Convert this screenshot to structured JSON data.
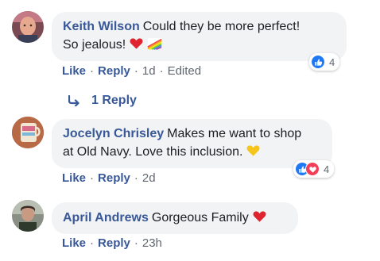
{
  "comments": [
    {
      "author": "Keith Wilson",
      "text_line1": "Could they be more perfect!",
      "text_line2": "So jealous!",
      "emojis": [
        "red-heart",
        "rainbow"
      ],
      "reaction_count": "4",
      "reactions": [
        "like"
      ],
      "actions": {
        "like": "Like",
        "reply": "Reply",
        "time": "1d",
        "edited": "Edited"
      },
      "replies_link": "1 Reply"
    },
    {
      "author": "Jocelyn Chrisley",
      "text_line1": "Makes me want to shop",
      "text_line2": "at Old Navy. Love this inclusion.",
      "emojis": [
        "yellow-heart"
      ],
      "reaction_count": "4",
      "reactions": [
        "like",
        "love"
      ],
      "actions": {
        "like": "Like",
        "reply": "Reply",
        "time": "2d"
      }
    },
    {
      "author": "April Andrews",
      "text_line1": "Gorgeous Family",
      "emojis": [
        "red-heart"
      ],
      "actions": {
        "like": "Like",
        "reply": "Reply",
        "time": "23h"
      }
    }
  ],
  "colors": {
    "link": "#385898",
    "bubble": "#f2f3f5",
    "meta": "#606770",
    "like": "#2078f4",
    "love": "#f33e58"
  },
  "separator": "·"
}
